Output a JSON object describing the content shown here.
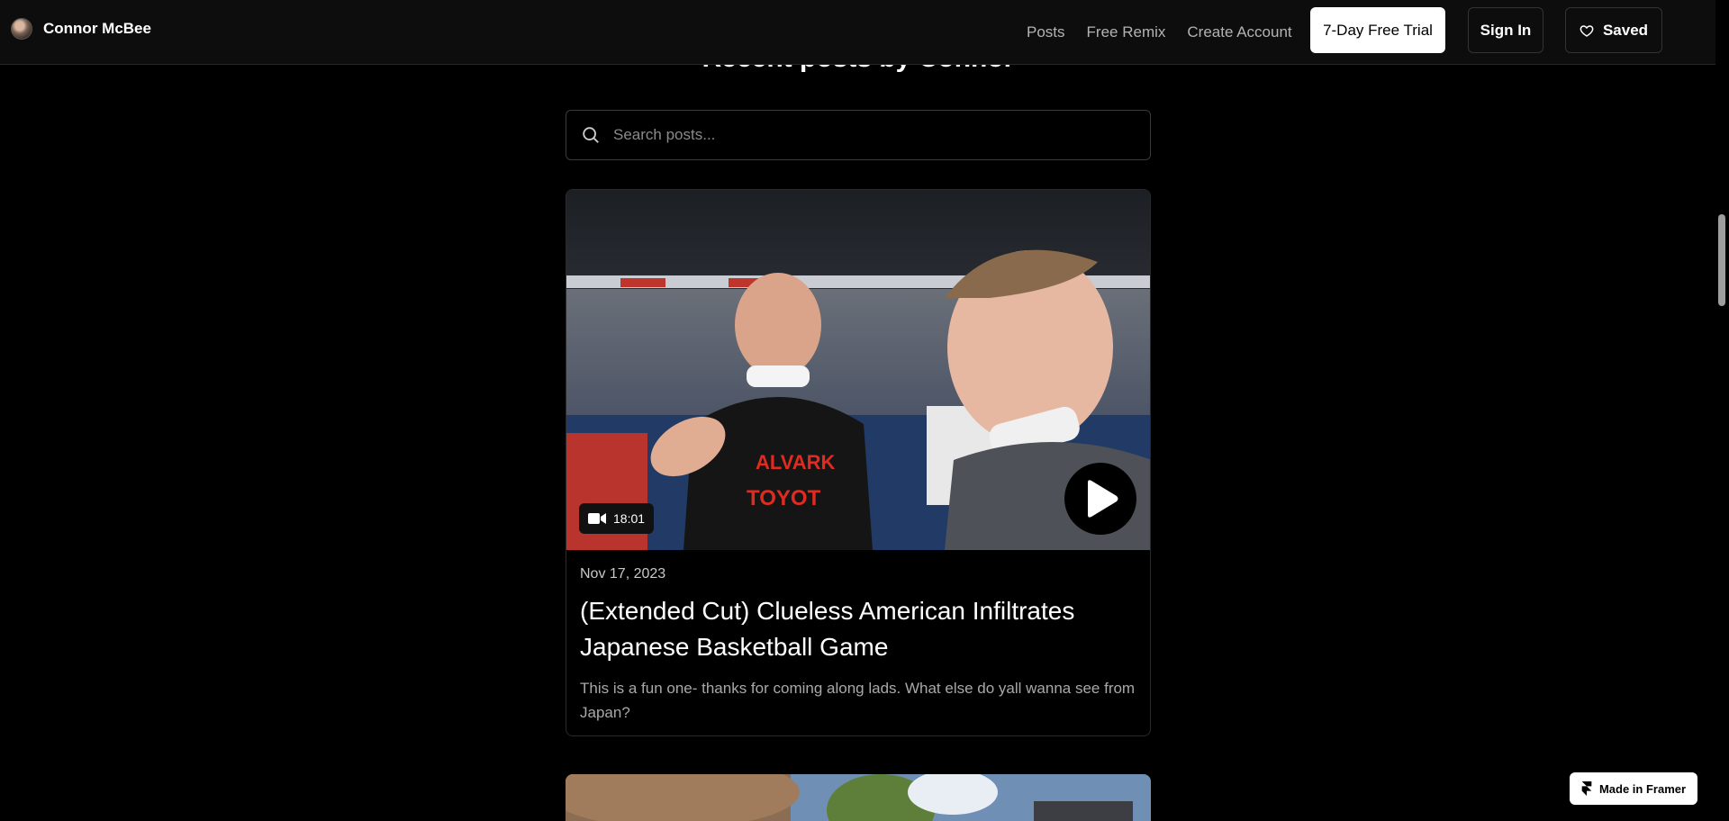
{
  "header": {
    "brand_name": "Connor McBee",
    "nav": [
      "Posts",
      "Free Remix",
      "Create Account"
    ],
    "trial_label": "7-Day Free Trial",
    "signin_label": "Sign In",
    "saved_label": "Saved"
  },
  "main": {
    "section_title": "Recent posts by Connor",
    "search_placeholder": "Search posts..."
  },
  "posts": [
    {
      "duration": "18:01",
      "date": "Nov 17, 2023",
      "title": "(Extended Cut) Clueless American Infiltrates Japanese Basketball Game",
      "excerpt": "This is a fun one- thanks for coming along lads. What else do yall wanna see from Japan?"
    }
  ],
  "badge": {
    "label": "Made in Framer"
  },
  "colors": {
    "background": "#000000",
    "header": "#0d0d0d",
    "text_muted": "#a8a8a8"
  }
}
